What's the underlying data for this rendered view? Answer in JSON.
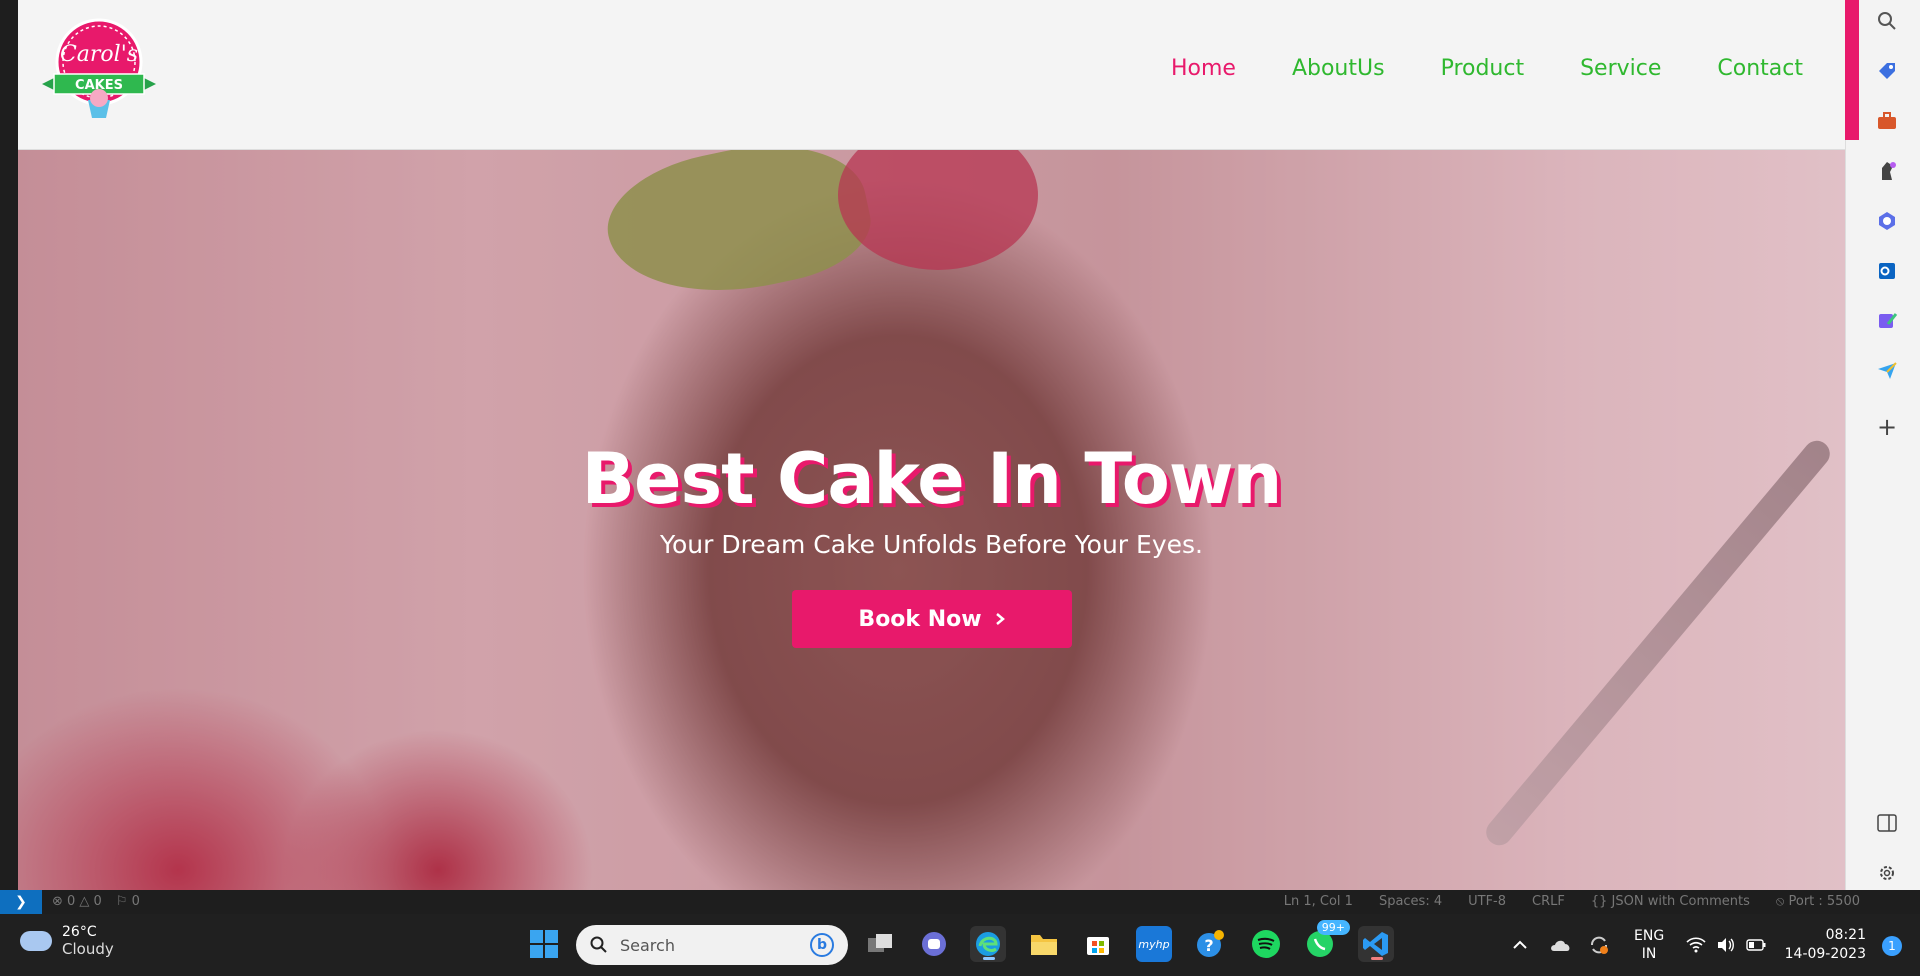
{
  "site": {
    "logo_line1": "Carol's",
    "logo_line2": "CAKES",
    "nav": [
      "Home",
      "AboutUs",
      "Product",
      "Service",
      "Contact"
    ],
    "hero_title": "Best Cake In Town",
    "hero_subtitle": "Your Dream Cake Unfolds Before Your Eyes.",
    "book_button": "Book Now",
    "book_icon": "chevron-right-icon",
    "colors": {
      "accent": "#e8196b",
      "nav_link": "#2fb82f",
      "logo_green": "#26a24a"
    }
  },
  "edge_sidebar": [
    "search-icon",
    "tag-icon",
    "briefcase-icon",
    "chess-icon",
    "copilot-icon",
    "outlook-icon",
    "designer-icon",
    "send-icon",
    "add-icon",
    "split-screen-icon",
    "settings-icon"
  ],
  "statusbar": {
    "left": [
      "⊗ 0 △ 0",
      "⚐ 0"
    ],
    "right": [
      "Ln 1, Col 1",
      "Spaces: 4",
      "UTF-8",
      "CRLF",
      "{} JSON with Comments",
      "⦸ Port : 5500"
    ]
  },
  "taskbar": {
    "weather_temp": "26°C",
    "weather_desc": "Cloudy",
    "search_placeholder": "Search",
    "apps": [
      "start-icon",
      "task-view-icon",
      "teams-icon",
      "edge-icon",
      "file-explorer-icon",
      "store-icon",
      "myhp-icon",
      "help-icon",
      "spotify-icon",
      "whatsapp-icon",
      "vscode-icon"
    ],
    "whatsapp_badge": "99+",
    "lang_line1": "ENG",
    "lang_line2": "IN",
    "time": "08:21",
    "date": "14-09-2023",
    "notifications": "1"
  }
}
